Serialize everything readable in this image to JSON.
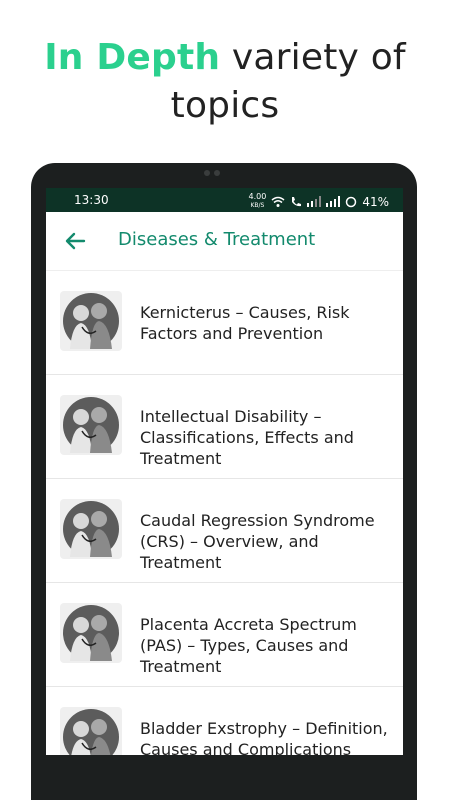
{
  "headline": {
    "accent": "In Depth",
    "rest": " variety of",
    "line2": "topics"
  },
  "status": {
    "time": "13:30",
    "speed": "4.00",
    "speed_unit": "KB/S",
    "battery": "41%"
  },
  "appbar": {
    "title": "Diseases & Treatment"
  },
  "items": [
    {
      "title": "Kernicterus – Causes, Risk Factors and Prevention"
    },
    {
      "title": "Intellectual Disability – Classifications, Effects and Treatment"
    },
    {
      "title": "Caudal Regression Syndrome (CRS) – Overview, and Treatment"
    },
    {
      "title": "Placenta Accreta Spectrum (PAS) – Types, Causes and Treatment"
    },
    {
      "title": "Bladder Exstrophy – Definition, Causes and Complications"
    }
  ],
  "colors": {
    "accent_green": "#2bd08e",
    "title_green": "#138a6d",
    "statusbar": "#0d3326"
  }
}
